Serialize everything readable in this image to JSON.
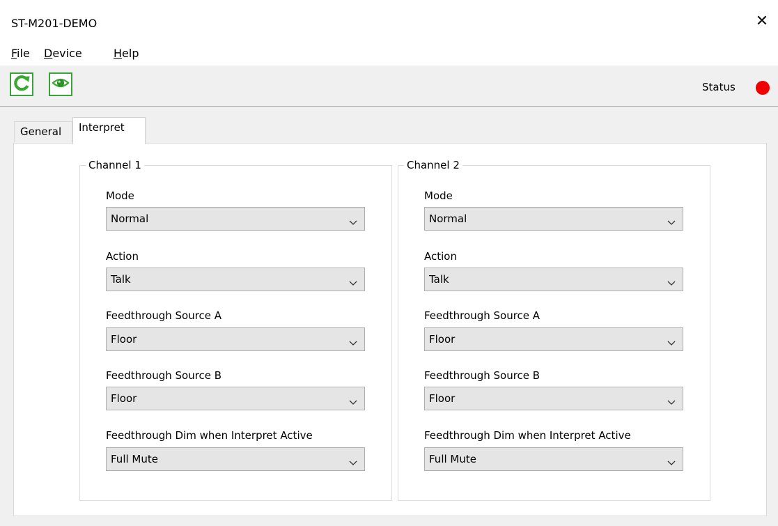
{
  "window": {
    "title": "ST-M201-DEMO",
    "close_glyph": "✕"
  },
  "menu": [
    {
      "mnemonic": "F",
      "rest": "ile"
    },
    {
      "mnemonic": "D",
      "rest": "evice"
    },
    {
      "mnemonic": "H",
      "rest": "elp"
    }
  ],
  "toolbar": {
    "refresh_icon": "refresh-icon",
    "monitor_icon": "eye-icon",
    "status_label": "Status",
    "status_color": "#f00000"
  },
  "tabs": [
    {
      "label": "General",
      "active": false
    },
    {
      "label": "Interpret",
      "active": true
    }
  ],
  "channels": [
    {
      "title": "Channel 1",
      "fields": [
        {
          "label": "Mode",
          "value": "Normal"
        },
        {
          "label": "Action",
          "value": "Talk"
        },
        {
          "label": "Feedthrough Source A",
          "value": "Floor"
        },
        {
          "label": "Feedthrough Source B",
          "value": "Floor"
        },
        {
          "label": "Feedthrough Dim when Interpret Active",
          "value": "Full Mute"
        }
      ]
    },
    {
      "title": "Channel 2",
      "fields": [
        {
          "label": "Mode",
          "value": "Normal"
        },
        {
          "label": "Action",
          "value": "Talk"
        },
        {
          "label": "Feedthrough Source A",
          "value": "Floor"
        },
        {
          "label": "Feedthrough Source B",
          "value": "Floor"
        },
        {
          "label": "Feedthrough Dim when Interpret Active",
          "value": "Full Mute"
        }
      ]
    }
  ]
}
